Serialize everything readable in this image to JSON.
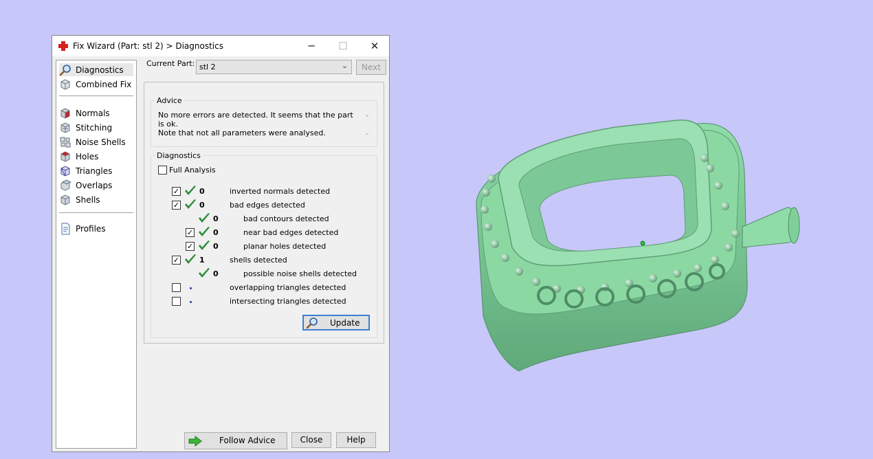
{
  "window": {
    "title": "Fix Wizard (Part: stl 2) > Diagnostics",
    "controls": {
      "minimize": "─",
      "maximize": "☐",
      "close": "✕"
    }
  },
  "nav": {
    "items": [
      {
        "label": "Diagnostics",
        "icon": "magnifier-icon",
        "selected": true
      },
      {
        "label": "Combined Fix",
        "icon": "cube-icon"
      },
      {
        "label": "Normals",
        "icon": "normals-cube-icon"
      },
      {
        "label": "Stitching",
        "icon": "stitching-cube-icon"
      },
      {
        "label": "Noise Shells",
        "icon": "noise-shells-icon"
      },
      {
        "label": "Holes",
        "icon": "holes-cube-icon"
      },
      {
        "label": "Triangles",
        "icon": "triangles-cube-icon"
      },
      {
        "label": "Overlaps",
        "icon": "overlaps-cube-icon"
      },
      {
        "label": "Shells",
        "icon": "shells-cube-icon"
      },
      {
        "label": "Profiles",
        "icon": "profile-document-icon"
      }
    ]
  },
  "current_part": {
    "label": "Current Part:",
    "value": "stl 2"
  },
  "next_button": "Next",
  "advice": {
    "title": "Advice",
    "line1": "No more errors are detected. It seems that the part is ok.",
    "line2": "Note that not all parameters were analysed."
  },
  "diagnostics": {
    "title": "Diagnostics",
    "full_analysis": {
      "label": "Full Analysis",
      "checked": false
    },
    "rows": [
      {
        "checkbox": true,
        "checked": true,
        "status": "ok",
        "count": "0",
        "label": "inverted normals detected",
        "indent": 0
      },
      {
        "checkbox": true,
        "checked": true,
        "status": "ok",
        "count": "0",
        "label": "bad edges detected",
        "indent": 0
      },
      {
        "checkbox": false,
        "checked": false,
        "status": "ok",
        "count": "0",
        "label": "bad contours detected",
        "indent": 1
      },
      {
        "checkbox": true,
        "checked": true,
        "status": "ok",
        "count": "0",
        "label": "near bad edges detected",
        "indent": 1
      },
      {
        "checkbox": true,
        "checked": true,
        "status": "ok",
        "count": "0",
        "label": "planar holes detected",
        "indent": 1
      },
      {
        "checkbox": true,
        "checked": true,
        "status": "ok",
        "count": "1",
        "label": "shells detected",
        "indent": 0
      },
      {
        "checkbox": false,
        "checked": false,
        "status": "ok",
        "count": "0",
        "label": "possible noise shells detected",
        "indent": 1
      },
      {
        "checkbox": true,
        "checked": false,
        "status": "pending",
        "count": "",
        "label": "overlapping triangles detected",
        "indent": 0
      },
      {
        "checkbox": true,
        "checked": false,
        "status": "pending",
        "count": "",
        "label": "intersecting triangles detected",
        "indent": 0
      }
    ]
  },
  "buttons": {
    "update": "Update",
    "follow_advice": "Follow Advice",
    "close": "Close",
    "help": "Help"
  },
  "colors": {
    "background": "#c7c7f9",
    "model": "#7fcf98",
    "tick": "#2e8b3a",
    "selection_border": "#3c7fd1"
  }
}
